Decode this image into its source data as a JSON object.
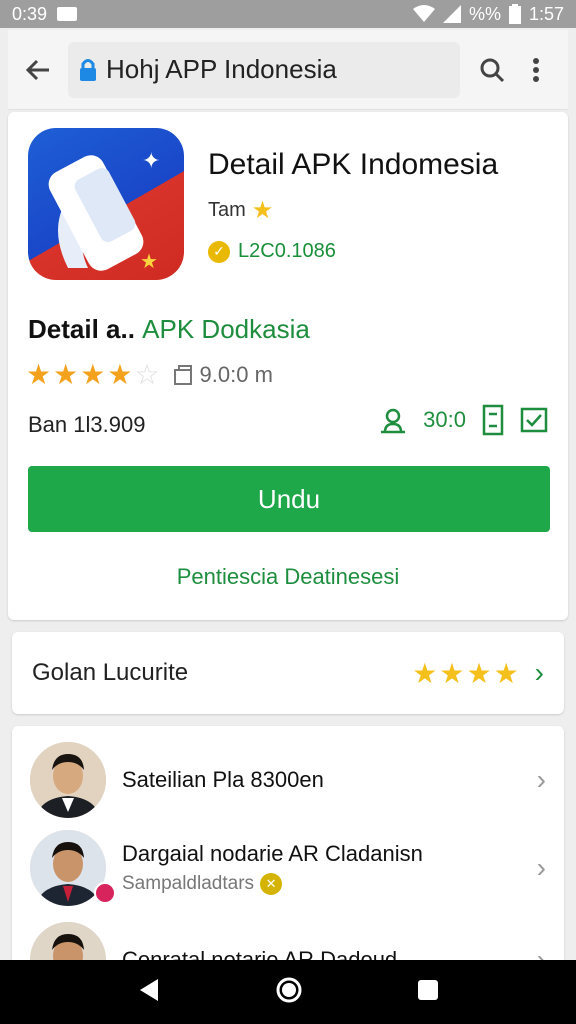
{
  "status": {
    "time": "0:39",
    "battery_pct": "%%",
    "clock": "1:57"
  },
  "appbar": {
    "url": "Hohj APP Indonesia"
  },
  "app": {
    "title": "Detail APK Indomesia",
    "developer": "Tam",
    "verified_code": "L2C0.1086"
  },
  "detail": {
    "heading_bold": "Detail a..",
    "heading_accent": "APK Dodkasia",
    "rating": 4.5,
    "size": "9.0:0 m",
    "version": "Ban 1l3.909",
    "downloads": "30:0",
    "download_label": "Undu",
    "link_text": "Pentiescia Deatinesesi"
  },
  "rating_card": {
    "label": "Golan Lucurite",
    "stars": 4
  },
  "list": [
    {
      "title": "Sateilian Pla 8300en",
      "subtitle": ""
    },
    {
      "title": "Dargaial nodarie AR Cladanisn",
      "subtitle": "Sampaldladtars"
    },
    {
      "title": "Conratal notarie AR Dadoud",
      "subtitle": ""
    }
  ],
  "colors": {
    "accent_green": "#1ea84a",
    "star_orange": "#f4a21d",
    "star_yellow": "#f5bf1c"
  }
}
